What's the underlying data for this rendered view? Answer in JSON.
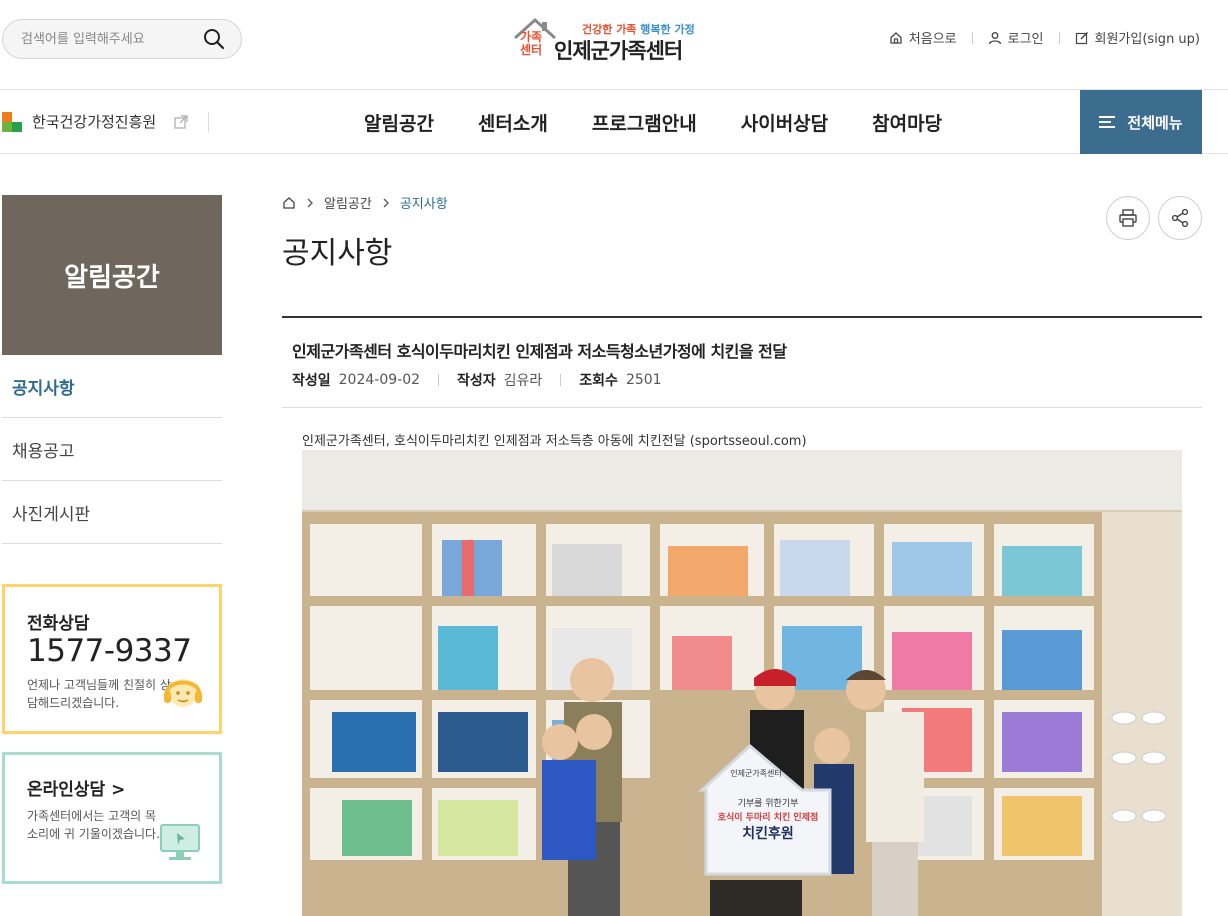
{
  "header": {
    "search_placeholder": "검색어를 입력해주세요",
    "logo_mark": "가족센터",
    "logo_slogan": [
      "건강한 가족",
      "행복한 가정"
    ],
    "logo_name": "인제군가족센터",
    "util": [
      {
        "label": "처음으로",
        "icon": "home-icon"
      },
      {
        "label": "로그인",
        "icon": "person-icon"
      },
      {
        "label": "회원가입(sign up)",
        "icon": "edit-icon"
      }
    ]
  },
  "gnb": {
    "org_link": "한국건강가정진흥원",
    "menu": [
      "알림공간",
      "센터소개",
      "프로그램안내",
      "사이버상담",
      "참여마당"
    ],
    "all_menu": "전체메뉴"
  },
  "sidebar": {
    "title": "알림공간",
    "items": [
      {
        "label": "공지사항",
        "active": true
      },
      {
        "label": "채용공고",
        "active": false
      },
      {
        "label": "사진게시판",
        "active": false
      }
    ],
    "phone": {
      "title": "전화상담",
      "number": "1577-9337",
      "desc": "언제나 고객님들께 친절히 상담해드리겠습니다."
    },
    "online": {
      "title": "온라인상담 >",
      "desc": "가족센터에서는 고객의 목소리에 귀 기울이겠습니다."
    }
  },
  "content": {
    "breadcrumb": [
      "알림공간",
      "공지사항"
    ],
    "page_title": "공지사항",
    "article": {
      "title": "인제군가족센터 호식이두마리치킨 인제점과 저소득청소년가정에 치킨을 전달",
      "date_label": "작성일",
      "date": "2024-09-02",
      "author_label": "작성자",
      "author": "김유라",
      "views_label": "조회수",
      "views": "2501",
      "caption": "인제군가족센터, 호식이두마리치킨 인제점과 저소득층 아동에 치킨전달 (sportsseoul.com)"
    },
    "sign": {
      "top": "인제군가족센터",
      "line1": "기부를 위한기부",
      "line2": "호식이 두마리 치킨 인제점",
      "line3": "치킨후원"
    }
  },
  "colors": {
    "accent": "#3c6d8f",
    "sidebar_title_bg": "#6f675b",
    "phone_border": "#ffd36c",
    "online_border": "#a8dccb"
  }
}
